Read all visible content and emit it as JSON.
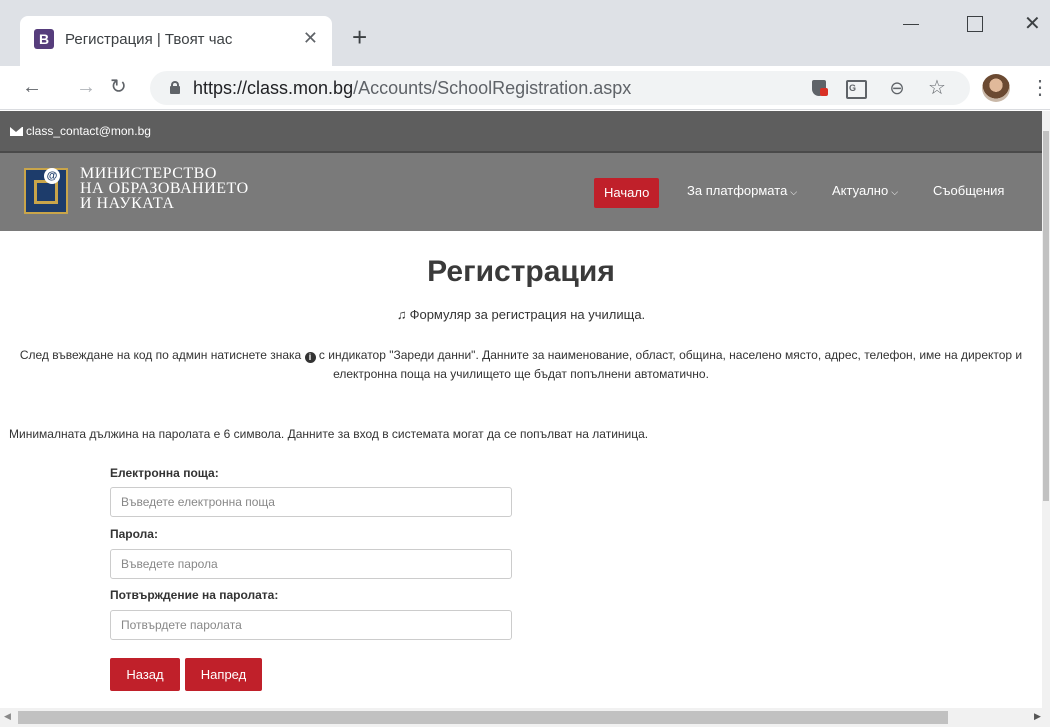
{
  "browser": {
    "tab_favicon": "B",
    "tab_title": "Регистрация | Твоят час",
    "tab_close": "✕",
    "new_tab": "+",
    "url_host": "https://class.mon.bg",
    "url_path": "/Accounts/SchoolRegistration.aspx",
    "icons": [
      "back-icon",
      "forward-icon",
      "reload-icon",
      "lock-icon",
      "extension-shield-icon",
      "translate-icon",
      "zoom-icon",
      "star-icon",
      "profile-avatar",
      "menu-icon"
    ]
  },
  "topbar": {
    "email": "class_contact@mon.bg"
  },
  "header": {
    "logo_lines": [
      "МИНИСТЕРСТВО",
      "НА ОБРАЗОВАНИЕТО",
      "И НАУКАТА"
    ],
    "nav": {
      "home": "Начало",
      "platform": "За платформата",
      "news": "Актуално",
      "messages": "Съобщения"
    },
    "accent_color": "#c0202a"
  },
  "main": {
    "title": "Регистрация",
    "subtitle": "Формуляр за регистрация на училища.",
    "info_before": "След въвеждане на код по админ натиснете знака",
    "info_after": "с индикатор \"Зареди данни\". Данните за наименование, област, община, населено място, адрес, телефон, име на директор и електронна поща на училището ще бъдат попълнени автоматично.",
    "password_note": "Минималната дължина на паролата е 6 символа. Данните за вход в системата могат да се попълват на латиница."
  },
  "form": {
    "email_label": "Електронна поща:",
    "email_placeholder": "Въведете електронна поща",
    "password_label": "Парола:",
    "password_placeholder": "Въведете парола",
    "confirm_label": "Потвърждение на паролата:",
    "confirm_placeholder": "Потвърдете паролата",
    "back_button": "Назад",
    "next_button": "Напред"
  }
}
